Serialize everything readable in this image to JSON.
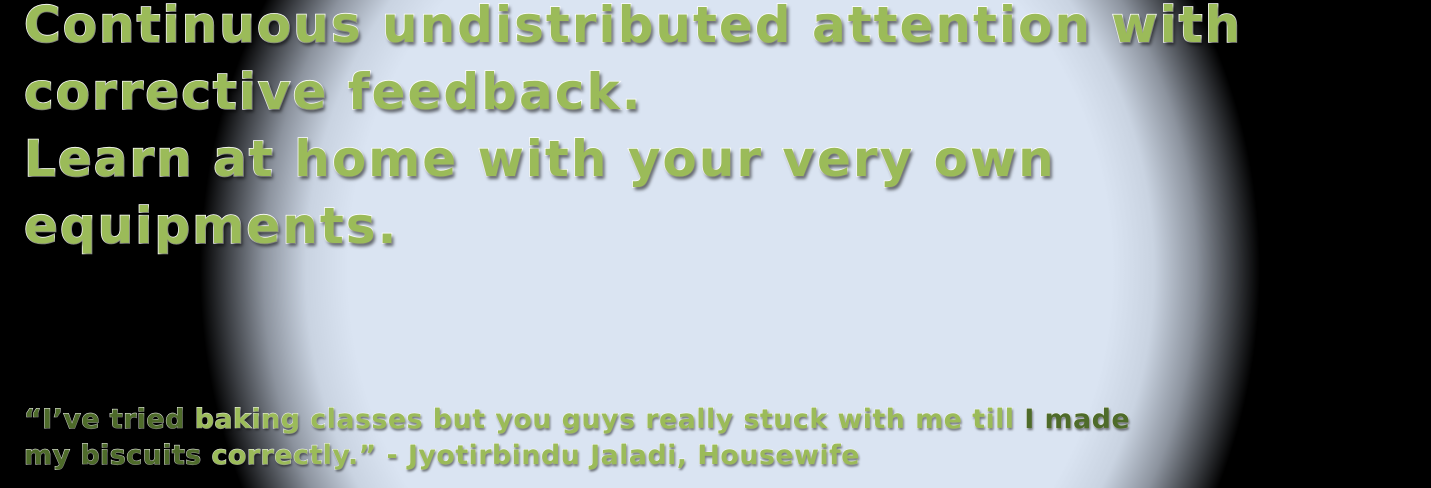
{
  "headline": {
    "line1": "Continuous undistributed attention with",
    "line2": "corrective feedback.",
    "line3": "Learn at home with your very own",
    "line4": "equipments."
  },
  "testimonial": {
    "line1_strong": "“I’ve tried",
    "line1_rest": " baking classes but you guys really stuck with me till ",
    "line1_end_strong": "I made",
    "line2_strong": "my biscuits",
    "line2_rest": " correctly.”  -  Jyotirbindu Jaladi, Housewife"
  },
  "colors": {
    "background": "#000000",
    "spotlight": "#dae4f2",
    "text_green": "#9bbb59",
    "text_outline": "#ffffff"
  }
}
